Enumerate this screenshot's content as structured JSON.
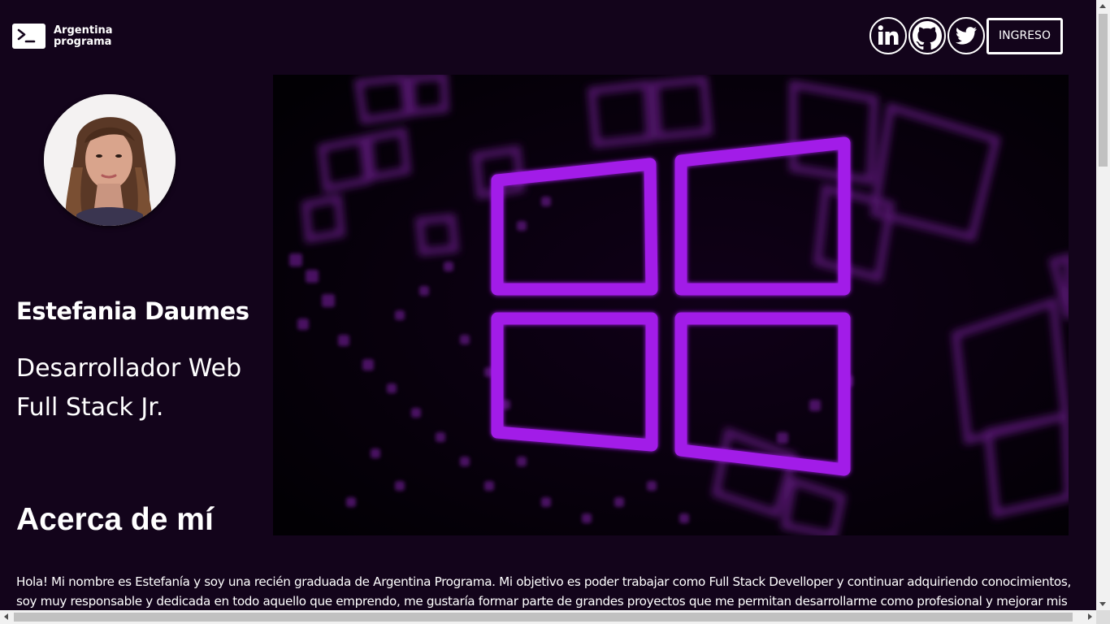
{
  "header": {
    "logo_line1": "Argentina",
    "logo_line2": "programa",
    "social": [
      {
        "icon": "linkedin-icon"
      },
      {
        "icon": "github-icon"
      },
      {
        "icon": "twitter-icon"
      }
    ],
    "login_label": "INGRESO"
  },
  "banner": {
    "image": "windows-logo-purple-banner"
  },
  "profile": {
    "name": "Estefania Daumes",
    "role_line1": "Desarrollador Web",
    "role_line2": "Full Stack Jr."
  },
  "about": {
    "title": "Acerca de mí",
    "text": "Hola! Mi nombre es Estefanía y soy una recién graduada de Argentina Programa. Mi objetivo es poder trabajar como Full Stack Develloper y continuar adquiriendo conocimientos, soy muy responsable y dedicada en todo aquello que emprendo, me gustaría formar parte de grandes proyectos que me permitan desarrollarme como profesional y mejorar mis"
  },
  "colors": {
    "background": "#13041b",
    "accent": "#a020f0",
    "text": "#ffffff"
  }
}
